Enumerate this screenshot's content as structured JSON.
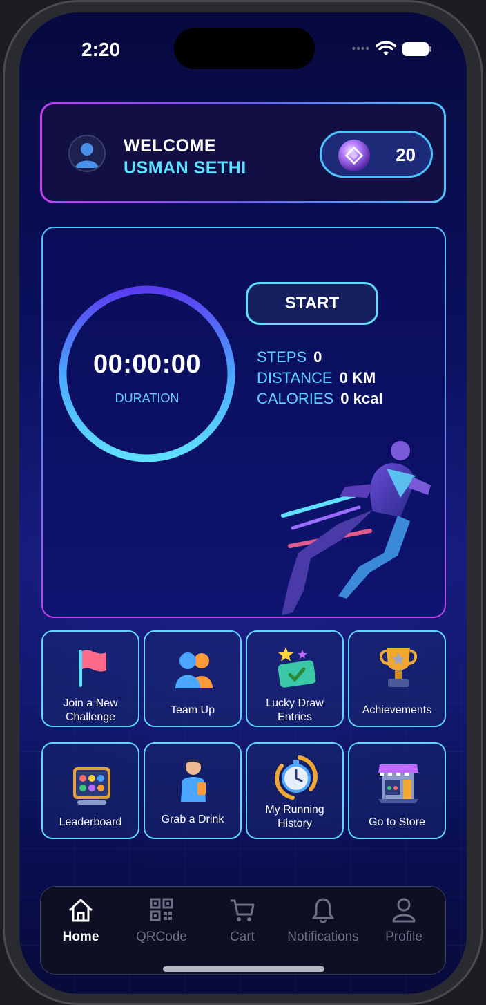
{
  "status_bar": {
    "time": "2:20",
    "signal_dots": "••••"
  },
  "header": {
    "welcome": "WELCOME",
    "username": "USMAN SETHI",
    "coins": "20",
    "coin_icon": "coin-icon"
  },
  "activity": {
    "timer": "00:00:00",
    "timer_label": "DURATION",
    "start_label": "START",
    "stats": [
      {
        "label": "STEPS",
        "value": "0"
      },
      {
        "label": "DISTANCE",
        "value": "0 KM"
      },
      {
        "label": "CALORIES",
        "value": "0 kcal"
      }
    ]
  },
  "tiles": [
    {
      "label": "Join a New Challenge",
      "icon": "flag-icon"
    },
    {
      "label": "Team Up",
      "icon": "team-icon"
    },
    {
      "label": "Lucky Draw Entries",
      "icon": "ticket-icon"
    },
    {
      "label": "Achievements",
      "icon": "trophy-icon"
    },
    {
      "label": "Leaderboard",
      "icon": "leaderboard-icon"
    },
    {
      "label": "Grab a Drink",
      "icon": "drink-icon"
    },
    {
      "label": "My Running History",
      "icon": "stopwatch-icon"
    },
    {
      "label": "Go to Store",
      "icon": "store-icon"
    }
  ],
  "nav": {
    "items": [
      {
        "label": "Home",
        "icon": "home-icon",
        "active": true
      },
      {
        "label": "QRCode",
        "icon": "qrcode-icon",
        "active": false
      },
      {
        "label": "Cart",
        "icon": "cart-icon",
        "active": false
      },
      {
        "label": "Notifications",
        "icon": "bell-icon",
        "active": false
      },
      {
        "label": "Profile",
        "icon": "profile-icon",
        "active": false
      }
    ]
  },
  "colors": {
    "accent_cyan": "#5fe0ff",
    "accent_magenta": "#c03ef0",
    "background": "#0a0f5c"
  }
}
